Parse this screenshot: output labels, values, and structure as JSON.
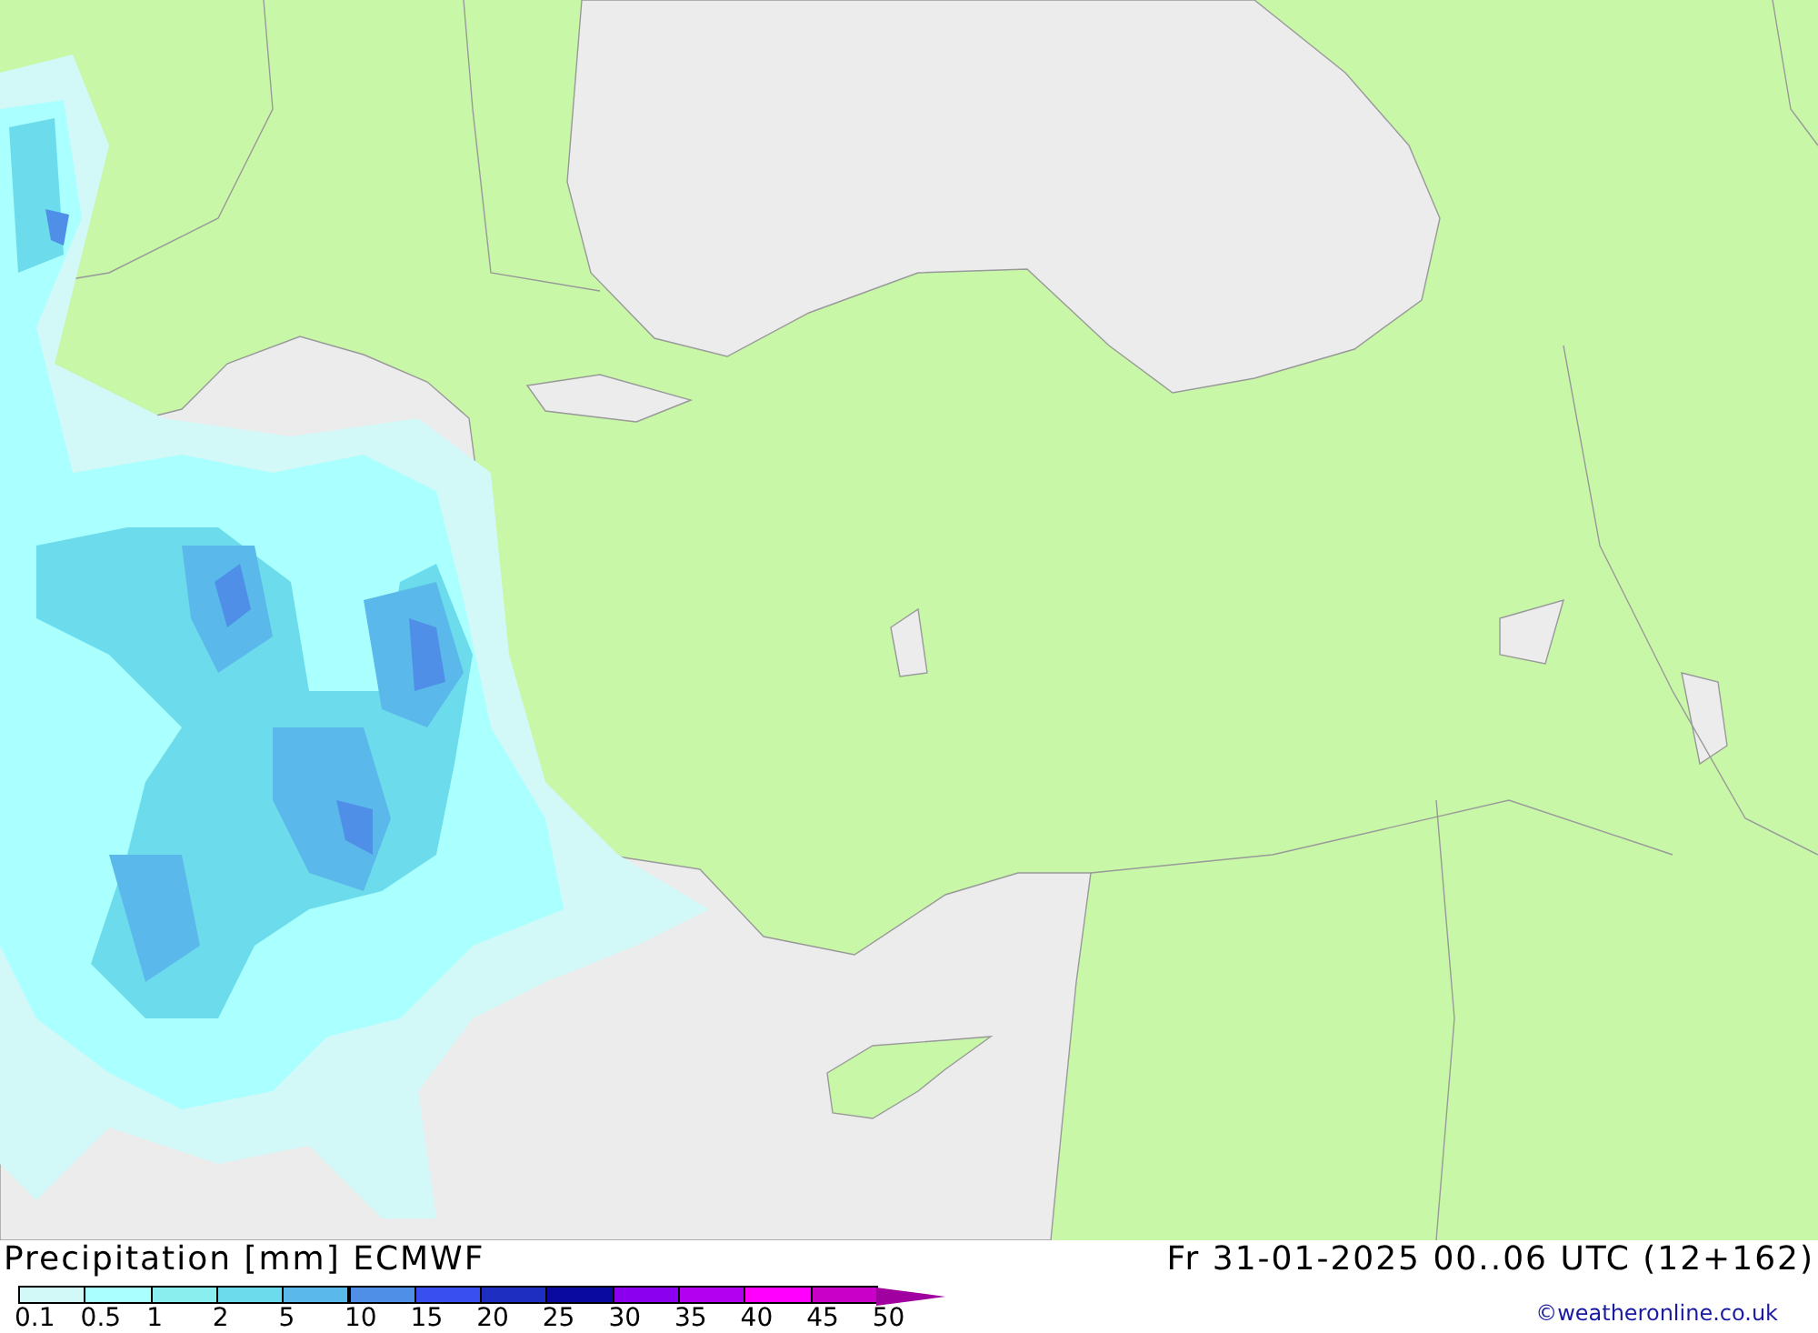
{
  "title": "Precipitation [mm] ECMWF",
  "valid_time": "Fr 31-01-2025 00..06 UTC (12+162)",
  "legend": [
    {
      "label": "0.1",
      "color": "#d2f8f8",
      "kind": "box"
    },
    {
      "label": "0.5",
      "color": "#aaffff",
      "kind": "box"
    },
    {
      "label": "1",
      "color": "#8aeeee",
      "kind": "box"
    },
    {
      "label": "2",
      "color": "#6cdcec",
      "kind": "box"
    },
    {
      "label": "5",
      "color": "#5ab8ea",
      "kind": "box"
    },
    {
      "label": "10",
      "color": "#4f8fe8",
      "kind": "box"
    },
    {
      "label": "15",
      "color": "#3a4ff0",
      "kind": "box"
    },
    {
      "label": "20",
      "color": "#1e2ec0",
      "kind": "box"
    },
    {
      "label": "25",
      "color": "#0a0aa0",
      "kind": "box"
    },
    {
      "label": "30",
      "color": "#8c00f0",
      "kind": "box"
    },
    {
      "label": "35",
      "color": "#b400f0",
      "kind": "box"
    },
    {
      "label": "40",
      "color": "#ff00ff",
      "kind": "box"
    },
    {
      "label": "45",
      "color": "#c800c8",
      "kind": "box"
    },
    {
      "label": "50",
      "color": "#a000a0",
      "kind": "arrow"
    }
  ],
  "credit": "©weatheronline.co.uk"
}
